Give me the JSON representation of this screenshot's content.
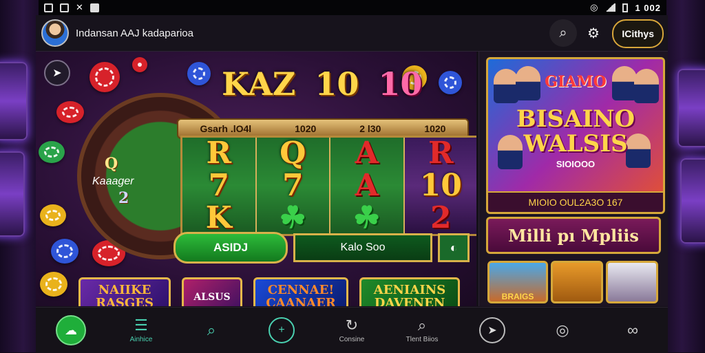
{
  "status_bar": {
    "time": "1 002"
  },
  "header": {
    "app_title": "Indansan AAJ kadaparioa",
    "account_button": "ICithys"
  },
  "game": {
    "title_words": [
      "KAZ",
      "10",
      "10"
    ],
    "wheel_text": "Q",
    "wheel_label": "Kaaager",
    "wheel_number": "2",
    "paybar": [
      "Gsarh .lO4l",
      "1020",
      "2 l30",
      "1020"
    ],
    "reels": [
      [
        "R",
        "7",
        "K"
      ],
      [
        "Q",
        "7",
        "☘"
      ],
      [
        "A",
        "A",
        "☘"
      ],
      [
        "R",
        "10",
        "2"
      ]
    ],
    "spin_label": "ASIDJ",
    "mid_label": "Kalo Soo",
    "small_label": "◐",
    "thumbs": [
      "NAIIKE RASGES",
      "ALSUS",
      "CENNAE! CAANAER",
      "AENIAINS DAVENEN"
    ]
  },
  "panel": {
    "promo_top": "GIAMO",
    "promo_main_1": "BISAINO",
    "promo_main_2": "WALSIS",
    "promo_sub": "SIOIOOO",
    "promo_foot": "MIOIO OUL2A3O 167",
    "banner": "Milli pı Mpliis",
    "mini_labels": [
      "BRAIGS",
      "",
      ""
    ]
  },
  "bottom_nav": [
    {
      "icon": "home-icon",
      "glyph": "☁",
      "label": ""
    },
    {
      "icon": "trash-icon",
      "glyph": "☰",
      "label": "Ainhice"
    },
    {
      "icon": "search-icon",
      "glyph": "⌕",
      "label": ""
    },
    {
      "icon": "plus-icon",
      "glyph": "+",
      "label": ""
    },
    {
      "icon": "refresh-icon",
      "glyph": "↻",
      "label": "Consine"
    },
    {
      "icon": "magnifier-icon",
      "glyph": "⌕",
      "label": "Tlent Biios"
    },
    {
      "icon": "send-icon",
      "glyph": "➤",
      "label": ""
    },
    {
      "icon": "target-icon",
      "glyph": "◎",
      "label": ""
    },
    {
      "icon": "infinity-icon",
      "glyph": "∞",
      "label": ""
    }
  ],
  "colors": {
    "accent_gold": "#d6a83a",
    "accent_green": "#1fae3a",
    "accent_teal": "#4ad0b0"
  }
}
